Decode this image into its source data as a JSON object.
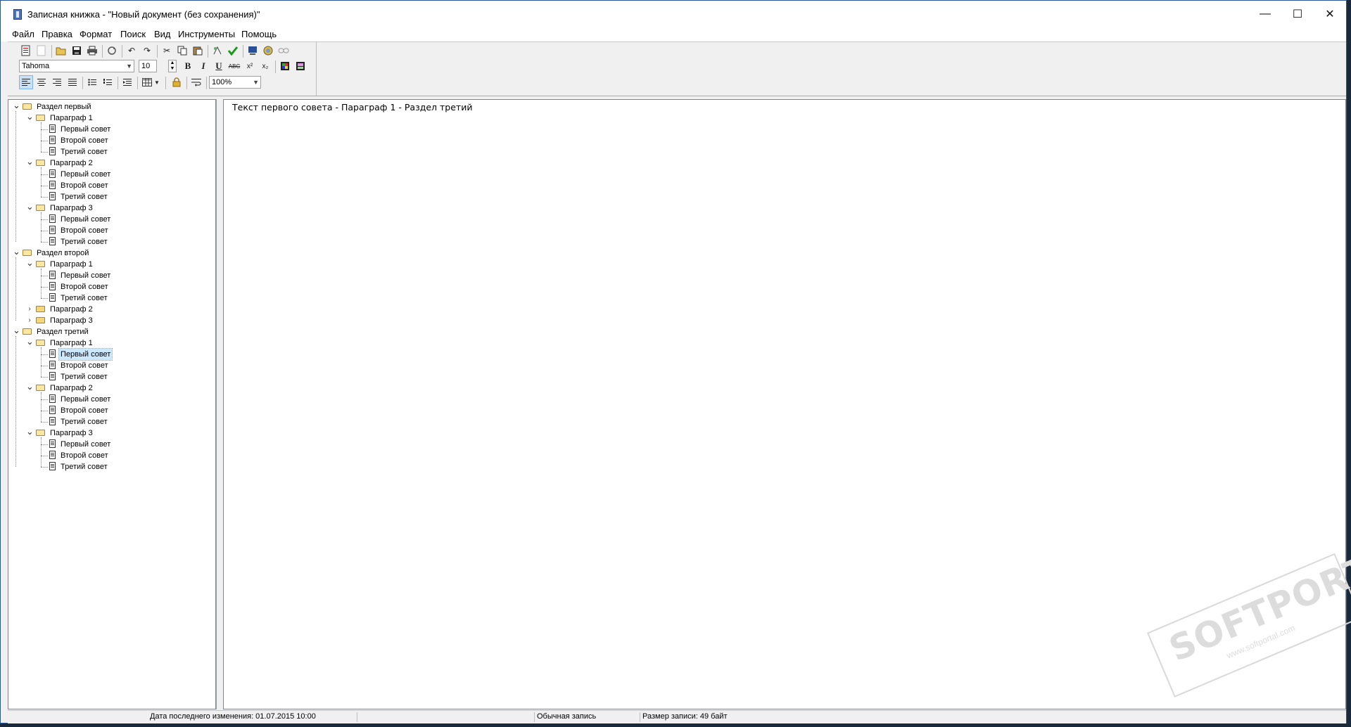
{
  "window": {
    "title": "Записная книжка - \"Новый документ (без сохранения)\"",
    "controls": {
      "minimize": "—",
      "maximize": "☐",
      "close": "✕"
    }
  },
  "menu": [
    "Файл",
    "Правка",
    "Формат",
    "Поиск",
    "Вид",
    "Инструменты",
    "Помощь"
  ],
  "toolbar": {
    "font_name": "Tahoma",
    "font_size": "10",
    "zoom": "100%",
    "bold_label": "B",
    "italic_label": "I",
    "underline_label": "U",
    "strike_label": "ABC",
    "superscript_label": "x²",
    "subscript_label": "x₂"
  },
  "tree": [
    {
      "label": "Раздел первый",
      "expanded": true,
      "children": [
        {
          "label": "Параграф 1",
          "expanded": true,
          "children": [
            "Первый совет",
            "Второй совет",
            "Третий совет"
          ]
        },
        {
          "label": "Параграф 2",
          "expanded": true,
          "children": [
            "Первый совет",
            "Второй совет",
            "Третий совет"
          ]
        },
        {
          "label": "Параграф 3",
          "expanded": true,
          "children": [
            "Первый совет",
            "Второй совет",
            "Третий совет"
          ]
        }
      ]
    },
    {
      "label": "Раздел второй",
      "expanded": true,
      "children": [
        {
          "label": "Параграф 1",
          "expanded": true,
          "children": [
            "Первый совет",
            "Второй совет",
            "Третий совет"
          ]
        },
        {
          "label": "Параграф 2",
          "expanded": false,
          "children": []
        },
        {
          "label": "Параграф 3",
          "expanded": false,
          "children": []
        }
      ]
    },
    {
      "label": "Раздел третий",
      "expanded": true,
      "children": [
        {
          "label": "Параграф 1",
          "expanded": true,
          "children": [
            "Первый совет",
            "Второй совет",
            "Третий совет"
          ]
        },
        {
          "label": "Параграф 2",
          "expanded": true,
          "children": [
            "Первый совет",
            "Второй совет",
            "Третий совет"
          ]
        },
        {
          "label": "Параграф 3",
          "expanded": true,
          "children": [
            "Первый совет",
            "Второй совет",
            "Третий совет"
          ]
        }
      ]
    }
  ],
  "selected_node": "Раздел третий / Параграф 1 / Первый совет",
  "editor": {
    "text": "Текст первого совета - Параграф 1 - Раздел третий"
  },
  "status": {
    "modified": "Дата последнего изменения: 01.07.2015 10:00",
    "record_type": "Обычная запись",
    "record_size": "Размер записи: 49 байт"
  },
  "watermark": {
    "main": "SOFTPORTAL",
    "sub": "www.softportal.com",
    "tm": "™"
  },
  "colors": {
    "selection": "#cce8ff",
    "window_border": "#2b5797",
    "folder": "#f5d77a"
  }
}
